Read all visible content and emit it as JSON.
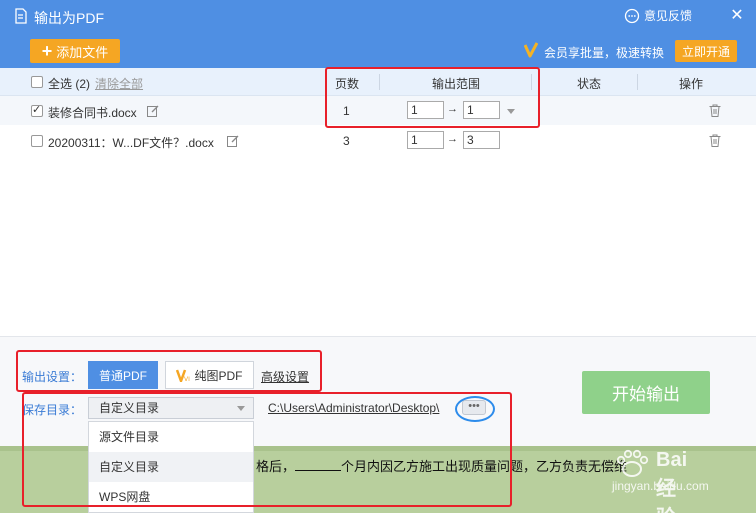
{
  "window": {
    "title": "输出为PDF",
    "feedback_label": "意见反馈",
    "close_glyph": "✕"
  },
  "toolbar": {
    "add_file_label": "添加文件",
    "vip_text": "会员享批量，极速转换",
    "open_vip_label": "立即开通"
  },
  "table": {
    "select_all_label": "全选 (2)",
    "clear_all_label": "清除全部",
    "headers": {
      "pages": "页数",
      "range": "输出范围",
      "status": "状态",
      "action": "操作"
    },
    "rows": [
      {
        "checked": true,
        "name": "装修合同书.docx",
        "pages": "1",
        "from": "1",
        "to": "1"
      },
      {
        "checked": false,
        "name": "20200311：W...DF文件？.docx",
        "pages": "3",
        "from": "1",
        "to": "3"
      }
    ],
    "range_arrow": "→"
  },
  "output_settings": {
    "label": "输出设置：",
    "normal_pdf": "普通PDF",
    "image_pdf": "纯图PDF",
    "advanced": "高级设置"
  },
  "save_dir": {
    "label": "保存目录：",
    "selected": "自定义目录",
    "path": "C:\\Users\\Administrator\\Desktop\\",
    "more_glyph": "•••",
    "options": [
      "源文件目录",
      "自定义目录",
      "WPS网盘"
    ]
  },
  "start_button": "开始输出",
  "background_doc": {
    "text_before": "格后，",
    "text_after": "个月内因乙方施工出现质量问题，乙方负责无偿维"
  },
  "watermark": {
    "big": "Bai 经验",
    "small": "jingyan.baidu.com"
  },
  "colors": {
    "titlebar": "#4f8fe3",
    "orange": "#f5a623",
    "start_green": "#8fd18a",
    "annotation_red": "#e8202a",
    "annotation_blue": "#2d8ceb"
  }
}
